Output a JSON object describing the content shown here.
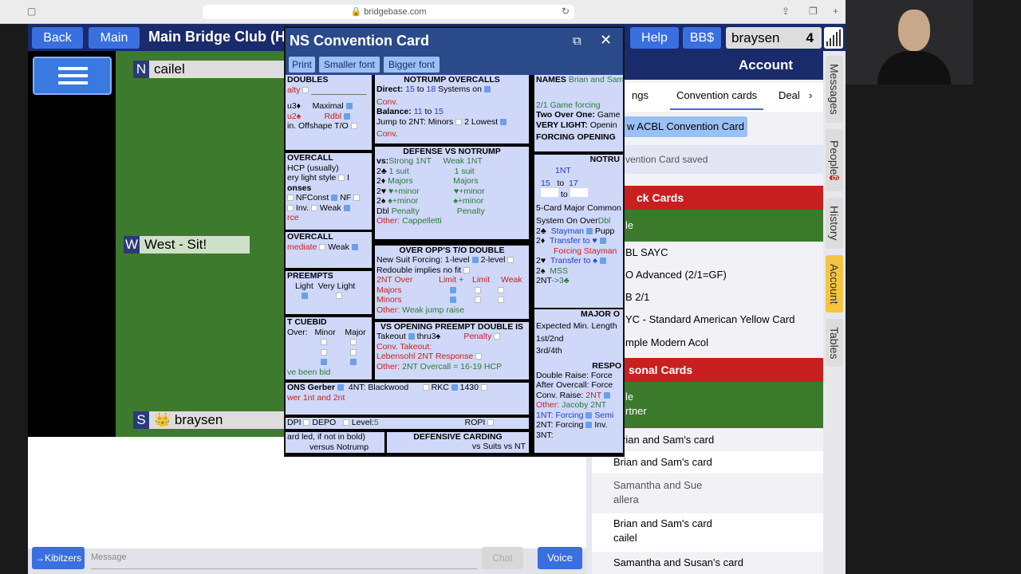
{
  "browser": {
    "url": "bridgebase.com"
  },
  "topbar": {
    "back": "Back",
    "home": "Main",
    "title": "Main Bridge Club (H",
    "help": "Help",
    "bbs": "BB$",
    "user": "braysen",
    "count": "4"
  },
  "seats": {
    "north": {
      "letter": "N",
      "name": "cailel"
    },
    "west": {
      "letter": "W",
      "name": "West - Sit!"
    },
    "south": {
      "letter": "S",
      "name": "braysen"
    }
  },
  "chat": {
    "kibitzers": "→Kibitzers",
    "placeholder": "Message",
    "chat": "Chat",
    "voice": "Voice"
  },
  "dialog": {
    "title": "NS Convention Card",
    "toolbar": [
      "Print",
      "Smaller font",
      "Bigger font"
    ],
    "doubles": {
      "h": "DOUBLES",
      "l1": "alty",
      "l2": "u3♦",
      "l2b": "Maximal",
      "l3": "u2♠",
      "l3b": "Rdbl",
      "l4": "in. Offshape T/O"
    },
    "overcall": {
      "h": "OVERCALL",
      "l1": "HCP (usually)",
      "l2": "ery light style",
      "l3": "onses",
      "l4": "NFConst",
      "l4b": "NF",
      "l5": "Inv.",
      "l5b": "Weak",
      "l6": "rce"
    },
    "overcall2": {
      "h": "OVERCALL",
      "l1": "mediate",
      "l1b": "Weak"
    },
    "preempts": {
      "h": "PREEMPTS",
      "l1": "Light",
      "l1b": "Very Light"
    },
    "cuebid": {
      "h": "T CUEBID",
      "l1": "Over:",
      "l1a": "Minor",
      "l1b": "Major",
      "l2": "ve been bid"
    },
    "slam": {
      "l1": "ONS Gerber",
      "l1b": "4NT: Blackwood",
      "l1c": "RKC",
      "l1d": "1430",
      "l2": "wer 1nt and 2nt"
    },
    "depo": {
      "a": "DPI",
      "b": "DEPO",
      "c": "Level:",
      "cv": "5",
      "d": "ROPI"
    },
    "nt_over": {
      "h": "NOTRUMP OVERCALLS",
      "direct": "Direct:",
      "d1": "15",
      "to": "to",
      "d2": "18",
      "sys": "Systems on",
      "conv": "Conv.",
      "bal": "Balance:",
      "b1": "11",
      "b2": "15",
      "jump": "Jump to 2NT: Minors",
      "low": "2 Lowest",
      "conv2": "Conv."
    },
    "def_nt": {
      "h": "DEFENSE VS NOTRUMP",
      "vs": "vs:",
      "strong": "Strong 1NT",
      "weak": "Weak 1NT",
      "rows": [
        [
          "2♣",
          "1 suit",
          "1 suit"
        ],
        [
          "2♦",
          "Majors",
          "Majors"
        ],
        [
          "2♥",
          "♥+minor",
          "♥+minor"
        ],
        [
          "2♠",
          "♠+minor",
          "♠+minor"
        ],
        [
          "Dbl",
          "Penalty",
          "Penalty"
        ]
      ],
      "other": "Other:",
      "otherv": "Cappelletti"
    },
    "over_to": {
      "h": "OVER OPP'S T/O DOUBLE",
      "l1": "New Suit Forcing: 1-level",
      "l1b": "2-level",
      "l2": "Redouble implies no fit",
      "l3": "2NT Over",
      "l3a": "Limit +",
      "l3b": "Limit",
      "l3c": "Weak",
      "l4": "Majors",
      "l5": "Minors",
      "other": "Other:",
      "otherv": "Weak jump raise"
    },
    "preempt_dbl": {
      "h": "VS OPENING PREEMPT DOUBLE IS",
      "l1": "Takeout",
      "l1b": "thru3♠",
      "l1c": "Penalty",
      "l2": "Conv. Takeout:",
      "l3": "Lebensohl 2NT Response",
      "other": "Other:",
      "otherv": "2NT Overcall = 16-19 HCP"
    },
    "carding": {
      "a": "ard led, if not in bold)",
      "b": "versus Notrump",
      "h": "DEFENSIVE CARDING",
      "c": "vs Suits vs NT"
    },
    "names": {
      "h": "NAMES",
      "v": "Brian and Sam"
    },
    "gen": {
      "l1": "2/1 Game forcing",
      "l2": "Two Over One:",
      "l2v": "Game",
      "l3": "VERY LIGHT:",
      "l3v": "Openin",
      "l4": "FORCING OPENING"
    },
    "ntopen": {
      "h": "NOTRU",
      "l1": "1NT",
      "l2a": "15",
      "l2b": "to",
      "l2c": "17",
      "l3": "to",
      "l4": "5-Card Major Common",
      "l5": "System On Over",
      "l5v": "Dbl",
      "rows": [
        [
          "2♣",
          "Stayman",
          "Pupp"
        ],
        [
          "2♦",
          "Transfer to ♥",
          ""
        ],
        [
          "",
          "Forcing Stayman",
          ""
        ],
        [
          "2♥",
          "Transfer to ♠",
          ""
        ],
        [
          "2♠",
          "MSS",
          ""
        ],
        [
          "2NT",
          "->3♣",
          ""
        ]
      ]
    },
    "major": {
      "h": "MAJOR O",
      "l1": "Expected Min. Length",
      "l2": "1st/2nd",
      "l3": "3rd/4th",
      "h2": "RESPO",
      "l4": "Double Raise: Force",
      "l5": "After Overcall: Force",
      "l6": "Conv. Raise:",
      "l6v": "2NT",
      "other": "Other:",
      "otherv": "Jacoby 2NT",
      "l7": "1NT: Forcing",
      "l7b": "Semi",
      "l8": "2NT: Forcing",
      "l8b": "Inv.",
      "l9": "3NT:"
    }
  },
  "account": {
    "header": "Account",
    "tabs": [
      "ngs",
      "Convention cards",
      "Deal"
    ],
    "new_button": "w ACBL Convention Card",
    "saved": "vention Card saved",
    "sections": [
      {
        "type": "red",
        "label": "ck Cards"
      },
      {
        "type": "green",
        "label": "le"
      },
      {
        "type": "row",
        "label": "BL SAYC"
      },
      {
        "type": "row",
        "label": "O Advanced (2/1=GF)"
      },
      {
        "type": "row",
        "label": "B 2/1"
      },
      {
        "type": "row",
        "label": "YC - Standard American Yellow Card"
      },
      {
        "type": "row",
        "label": "mple Modern Acol"
      },
      {
        "type": "red",
        "label": "sonal Cards"
      },
      {
        "type": "green2",
        "label": "le",
        "label2": "rtner"
      },
      {
        "type": "row",
        "label": "rian and Sam's card"
      },
      {
        "type": "bold",
        "label": "Brian and Sam's card"
      },
      {
        "type": "two",
        "label": "Samantha and Sue",
        "label2": "allera"
      },
      {
        "type": "two",
        "label": "Brian and Sam's card",
        "label2": "cailel"
      },
      {
        "type": "bold",
        "label": "Samantha and Susan's card"
      }
    ]
  },
  "vtabs": [
    "Messages",
    "People",
    "History",
    "Account",
    "Tables"
  ],
  "people_badge": "6"
}
